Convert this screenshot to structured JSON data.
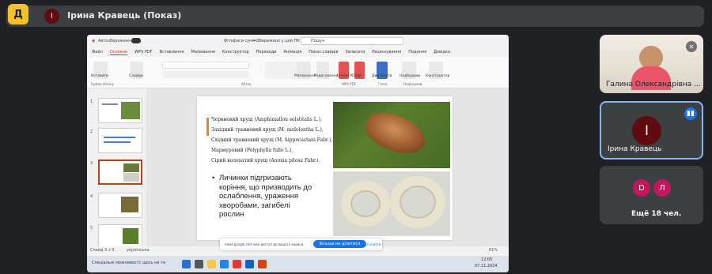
{
  "meeting": {
    "app_icon_letter": "Д",
    "presenter_initial": "І",
    "presenter_title": "Ірина Кравець (Показ)"
  },
  "powerpoint": {
    "title_bar": {
      "autosave_label": "Автозбереження",
      "file_name": "Фітофаги сунич...",
      "saved_status": "• Збережено у цей ПК",
      "search_placeholder": "Пошук"
    },
    "menu_tabs": [
      "Файл",
      "Основне",
      "WPS PDF",
      "Вставлення",
      "Малювання",
      "Конструктор",
      "Переходи",
      "Анімація",
      "Показ слайдів",
      "Записати",
      "Рецензування",
      "Подання",
      "Довідка"
    ],
    "active_tab": "Основне",
    "ribbon_labels": {
      "paste": "Вставити",
      "slides": "Слайди",
      "clipboard": "Буфер обміну",
      "paragraph": "Абзац",
      "draw": "Малювання",
      "edit": "Редагування",
      "create_pdf": "Create PDF",
      "sign": "Sign",
      "dictate": "Диктувати",
      "addins": "Надбудови",
      "designer": "Конструктор",
      "wps_pdf": "WPS PDF",
      "voice": "Голос",
      "addins_group": "Надбудови"
    },
    "thumbnails": [
      {
        "number": "1"
      },
      {
        "number": "2"
      },
      {
        "number": "3"
      },
      {
        "number": "4"
      },
      {
        "number": "5"
      }
    ],
    "slide": {
      "lines": [
        "Червневий хрущ (Amphimallon solstitalis L.),",
        "Західний травневий хрущ (M. melolontha L.),",
        "Східний травневий хрущ (M. hippocastani Fabr.),",
        "Мармуровий (Polyphylla fullo L.),",
        "Сірий волохатий хрущ (Anoxia pilosa Fabr.)."
      ],
      "bullet": "Личинки підгризають коріння, що призводить до ослаблення, ураження хворобами, загибелі рослин"
    },
    "status_bar": {
      "slide_count": "Слайд 3 з 9",
      "language": "українська",
      "zoom": "61%"
    },
    "share_notice": {
      "message": "meet.google.com має доступ до вашого екрана.",
      "stop_button": "Більше не ділитися",
      "hide_link": "Сховати"
    },
    "taskbar": {
      "search_label": "Спеціальні можливості: щось не те",
      "time": "12:05",
      "date": "07.11.2024"
    }
  },
  "participants": {
    "tile1_name": "Галина Олександрівна ...",
    "tile2_initial": "І",
    "tile2_name": "Ірина Кравець",
    "others": [
      {
        "initial": "D"
      },
      {
        "initial": "Л"
      }
    ],
    "more_label": "Ещё 18 чел."
  }
}
